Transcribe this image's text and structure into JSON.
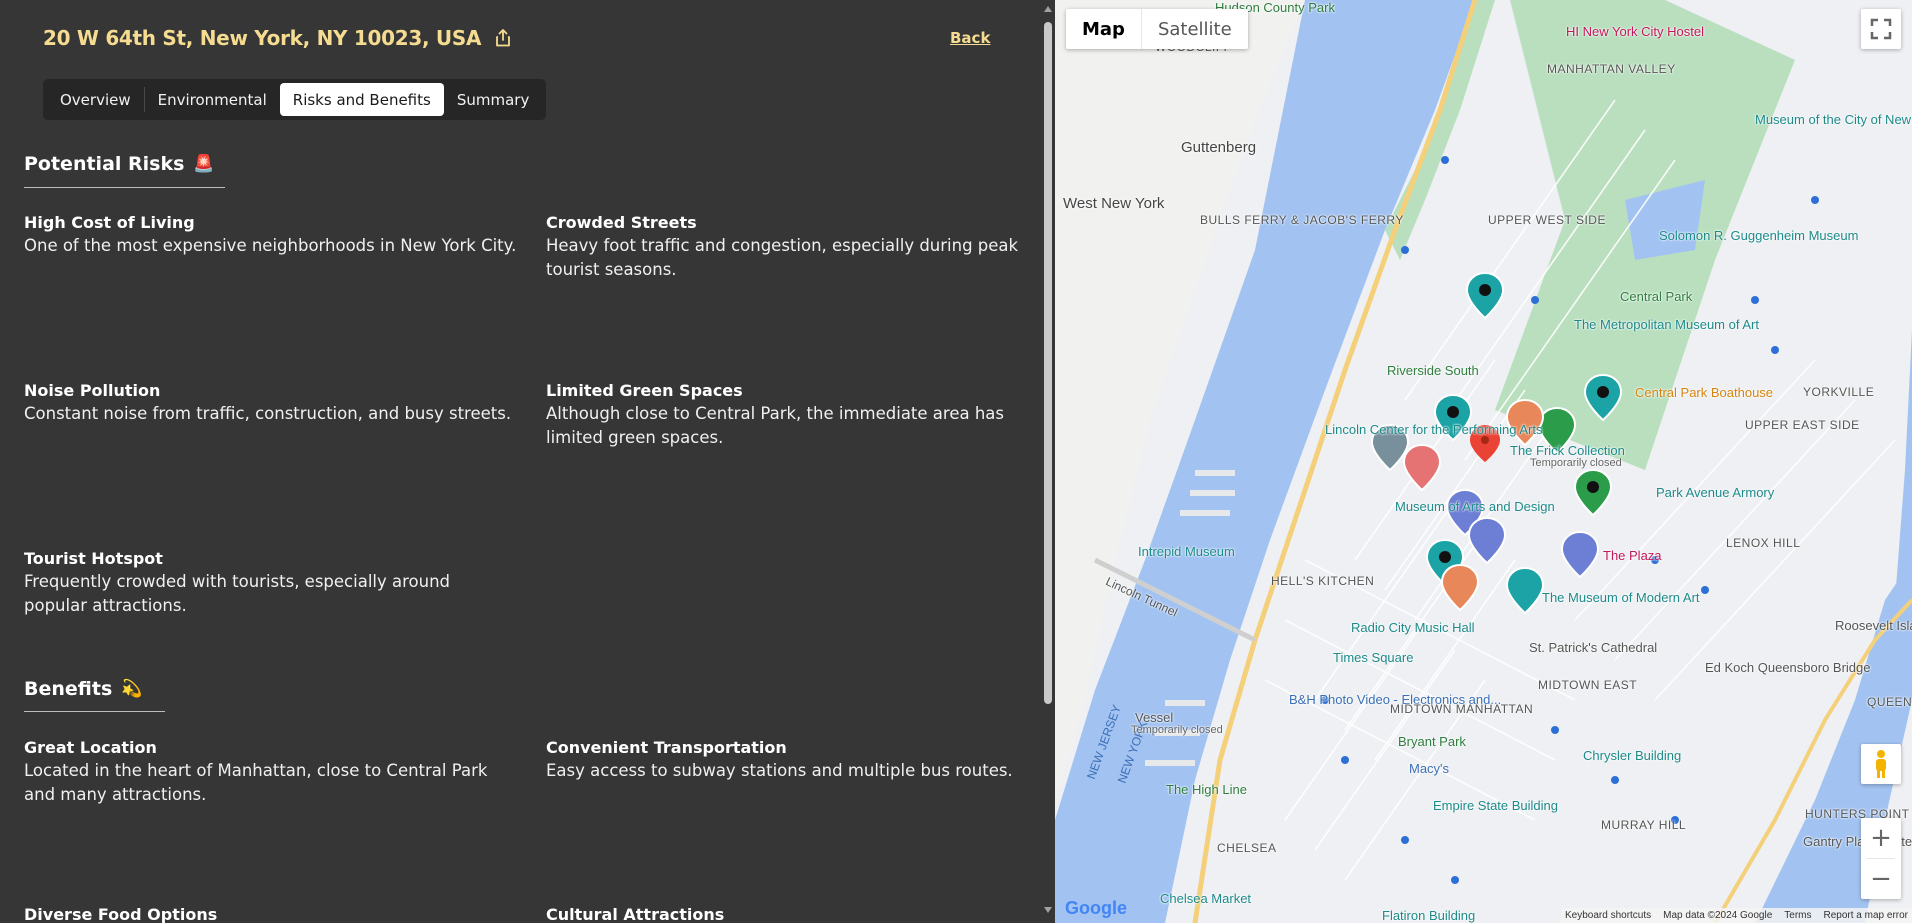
{
  "header": {
    "address": "20 W 64th St, New York, NY 10023, USA",
    "back_label": "Back"
  },
  "tabs": [
    {
      "label": "Overview",
      "active": false
    },
    {
      "label": "Environmental",
      "active": false
    },
    {
      "label": "Risks and Benefits",
      "active": true
    },
    {
      "label": "Summary",
      "active": false
    }
  ],
  "risks": {
    "title": "Potential Risks",
    "emoji": "🚨",
    "items": [
      {
        "title": "High Cost of Living",
        "desc": "One of the most expensive neighborhoods in New York City."
      },
      {
        "title": "Crowded Streets",
        "desc": "Heavy foot traffic and congestion, especially during peak tourist seasons."
      },
      {
        "title": "Noise Pollution",
        "desc": "Constant noise from traffic, construction, and busy streets."
      },
      {
        "title": "Limited Green Spaces",
        "desc": "Although close to Central Park, the immediate area has limited green spaces."
      },
      {
        "title": "Tourist Hotspot",
        "desc": "Frequently crowded with tourists, especially around popular attractions."
      }
    ]
  },
  "benefits": {
    "title": "Benefits",
    "emoji": "💫",
    "items": [
      {
        "title": "Great Location",
        "desc": "Located in the heart of Manhattan, close to Central Park and many attractions."
      },
      {
        "title": "Convenient Transportation",
        "desc": "Easy access to subway stations and multiple bus routes."
      },
      {
        "title": "Diverse Food Options",
        "desc": ""
      },
      {
        "title": "Cultural Attractions",
        "desc": ""
      }
    ]
  },
  "map": {
    "type_buttons": [
      "Map",
      "Satellite"
    ],
    "zoom_in": "+",
    "zoom_out": "−",
    "footer": [
      "Keyboard shortcuts",
      "Map data ©2024 Google",
      "Terms",
      "Report a map error"
    ],
    "logo": "Google",
    "labels": [
      "HI New York City Hostel",
      "MANHATTAN VALLEY",
      "Museum of the City of New York",
      "Guttenberg",
      "West New York",
      "BULLS FERRY & JACOB'S FERRY",
      "UPPER WEST SIDE",
      "Solomon R. Guggenheim Museum",
      "Central Park",
      "The Metropolitan Museum of Art",
      "Central Park Boathouse",
      "YORKVILLE",
      "UPPER EAST SIDE",
      "Riverside South",
      "Lincoln Center for the Performing Arts",
      "The Frick Collection",
      "Temporarily closed",
      "Park Avenue Armory",
      "LENOX HILL",
      "Museum of Arts and Design",
      "The Plaza",
      "Intrepid Museum",
      "HELL'S KITCHEN",
      "The Museum of Modern Art",
      "Radio City Music Hall",
      "St. Patrick's Cathedral",
      "Roosevelt Island",
      "Times Square",
      "MIDTOWN EAST",
      "Ed Koch Queensboro Bridge",
      "QUEENSB",
      "B&H Photo Video - Electronics and...",
      "MIDTOWN MANHATTAN",
      "Vessel",
      "Bryant Park",
      "Chrysler Building",
      "Macy's",
      "The High Line",
      "Empire State Building",
      "HUNTERS POINT",
      "MURRAY HILL",
      "Gantry Plaza State Park",
      "CHELSEA",
      "Chelsea Market",
      "Flatiron Building",
      "Hudson County Park",
      "WOODCLIFF",
      "NEW JERSEY",
      "NEW YORK",
      "Lincoln Tunnel",
      "Temporarily closed"
    ]
  }
}
